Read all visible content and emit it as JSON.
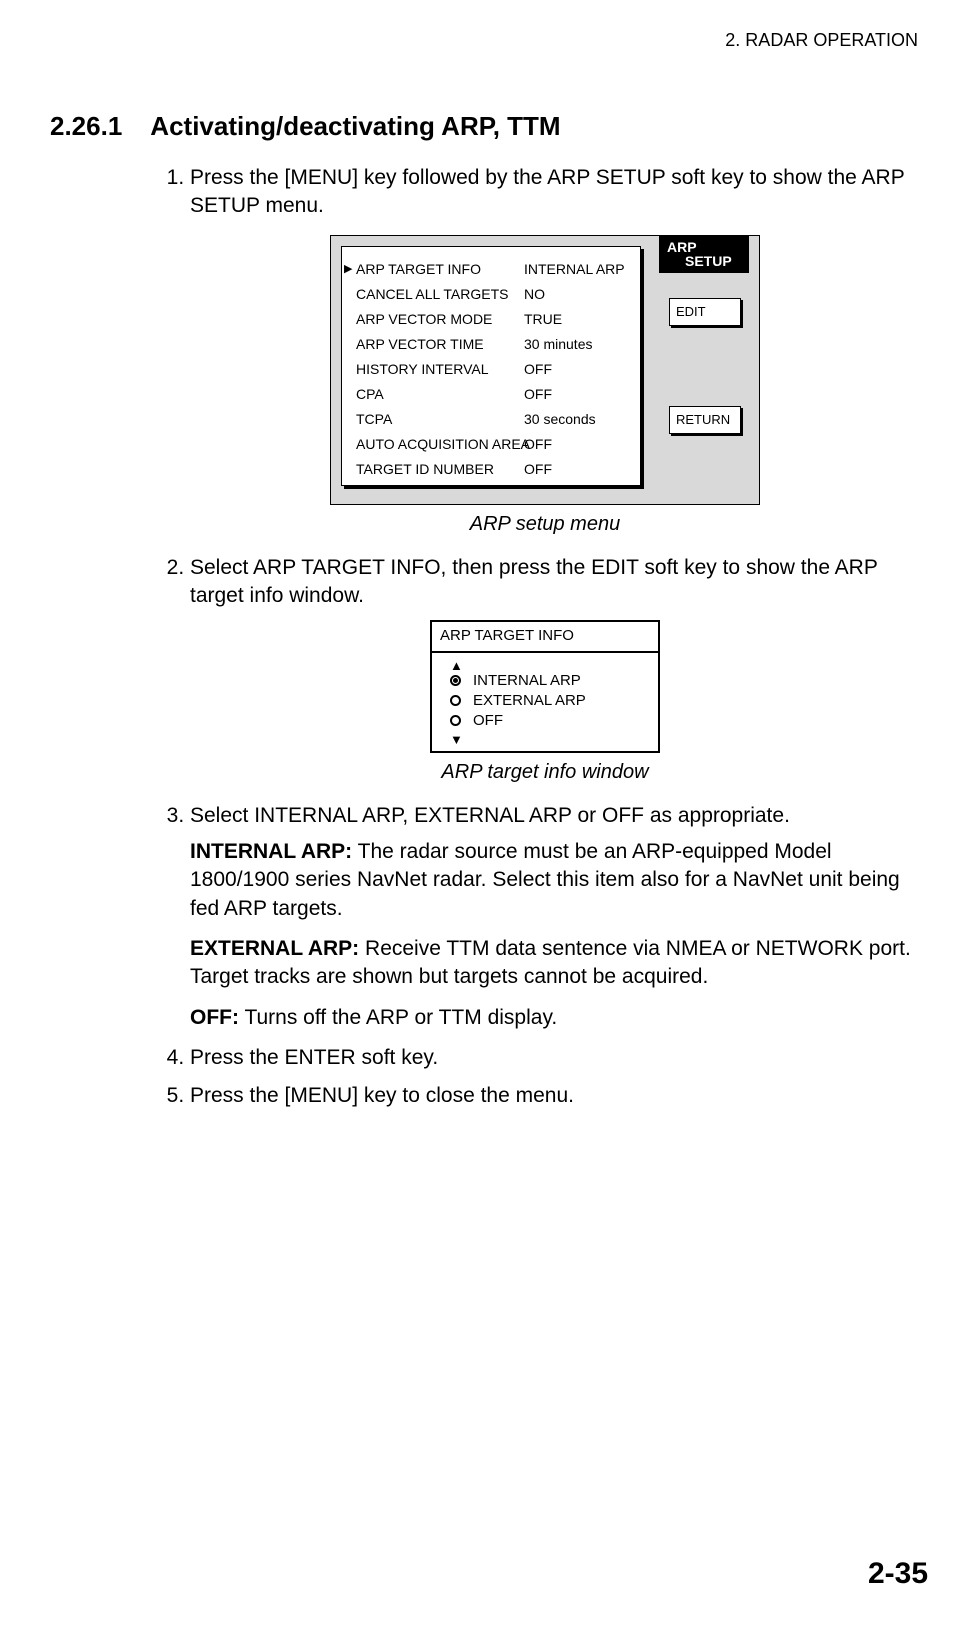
{
  "header": {
    "chapter": "2. RADAR OPERATION"
  },
  "section": {
    "number": "2.26.1",
    "title": "Activating/deactivating ARP, TTM"
  },
  "steps": {
    "s1": "Press the [MENU] key followed by the ARP SETUP soft key to show the ARP SETUP menu.",
    "s2": "Select ARP TARGET INFO, then press the EDIT soft key to show the ARP target info window.",
    "s3": "Select INTERNAL ARP, EXTERNAL ARP or OFF as appropriate.",
    "s4": "Press the ENTER soft key.",
    "s5": "Press the [MENU] key to close the menu."
  },
  "defs": {
    "internal": {
      "name": "INTERNAL ARP:",
      "text": " The radar source must be an ARP-equipped Model 1800/1900 series NavNet radar. Select this item also for a NavNet unit being fed ARP targets."
    },
    "external": {
      "name": "EXTERNAL ARP:",
      "text": " Receive TTM data sentence via NMEA or NETWORK port. Target tracks are shown but targets cannot be acquired."
    },
    "off": {
      "name": "OFF:",
      "text": " Turns off the ARP or TTM display."
    }
  },
  "fig1": {
    "tab_l1": "ARP",
    "tab_l2": "SETUP",
    "softkeys": {
      "edit": "EDIT",
      "return": "RETURN"
    },
    "rows": [
      {
        "label": "ARP TARGET INFO",
        "value": "INTERNAL ARP",
        "selected": true
      },
      {
        "label": "CANCEL ALL TARGETS",
        "value": "NO"
      },
      {
        "label": "ARP VECTOR MODE",
        "value": "TRUE"
      },
      {
        "label": "ARP VECTOR TIME",
        "value": "30 minutes"
      },
      {
        "label": "HISTORY INTERVAL",
        "value": "OFF"
      },
      {
        "label": "CPA",
        "value": "OFF"
      },
      {
        "label": "TCPA",
        "value": "30 seconds"
      },
      {
        "label": "AUTO ACQUISITION AREA",
        "value": "OFF"
      },
      {
        "label": "TARGET ID NUMBER",
        "value": "OFF"
      }
    ],
    "caption": "ARP setup menu"
  },
  "fig2": {
    "title": "ARP TARGET INFO",
    "options": [
      {
        "label": "INTERNAL ARP",
        "selected": true
      },
      {
        "label": "EXTERNAL ARP",
        "selected": false
      },
      {
        "label": "OFF",
        "selected": false
      }
    ],
    "caption": "ARP target info window"
  },
  "page_number": "2-35"
}
